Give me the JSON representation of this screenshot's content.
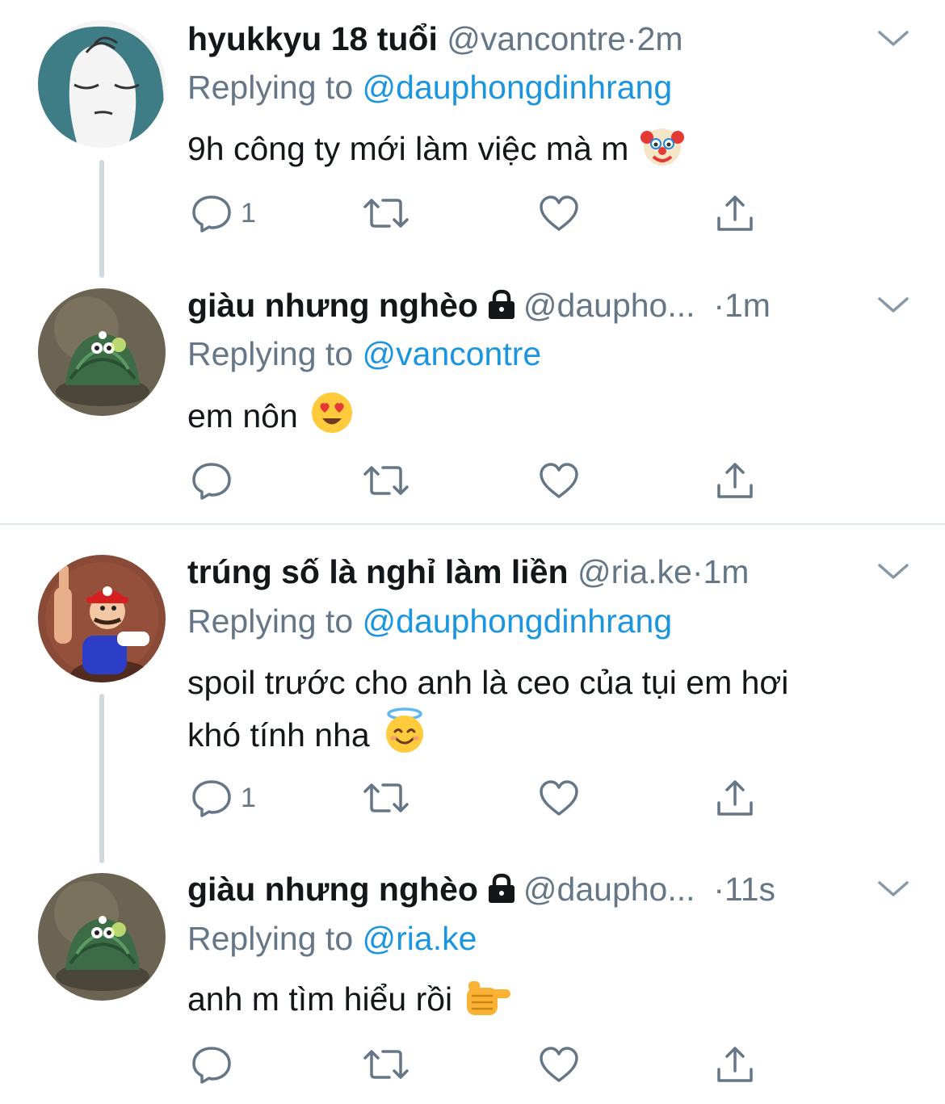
{
  "colors": {
    "name": "#14171a",
    "meta": "#657786",
    "mention": "#1b95e0",
    "icon": "#657786",
    "thread_line": "#cfd9de",
    "divider": "#e1e8ed"
  },
  "icons": {
    "reply": "speech-bubble-icon",
    "retweet": "retweet-icon",
    "like": "heart-icon",
    "share": "share-icon",
    "caret": "chevron-down-icon",
    "lock": "lock-icon"
  },
  "tweets": [
    {
      "name": "hyukkyu 18 tuổi",
      "handle": "@vancontre",
      "separator": "·",
      "time": "2m",
      "replying_prefix": "Replying to",
      "replying_to": "@dauphongdinhrang",
      "text": "9h công ty mới làm việc mà m",
      "emoji": "clown-face",
      "reply_count": "1"
    },
    {
      "name": "giàu nhưng nghèo",
      "handle": "@daupho...",
      "separator": "·",
      "time": "1m",
      "replying_prefix": "Replying to",
      "replying_to": "@vancontre",
      "text": "em nôn",
      "emoji": "heart-eyes-face",
      "reply_count": ""
    },
    {
      "name": "trúng số là nghỉ làm liền",
      "handle": "@ria.ke",
      "separator": "·",
      "time": "1m",
      "replying_prefix": "Replying to",
      "replying_to": "@dauphongdinhrang",
      "text_line1": "spoil trước cho anh là ceo của tụi em hơi",
      "text_line2": "khó tính nha",
      "emoji": "smiling-face-with-halo",
      "reply_count": "1"
    },
    {
      "name": "giàu nhưng nghèo",
      "handle": "@daupho...",
      "separator": "·",
      "time": "11s",
      "replying_prefix": "Replying to",
      "replying_to": "@ria.ke",
      "text": "anh m tìm hiểu rồi",
      "emoji": "backhand-pointing-right",
      "reply_count": ""
    }
  ]
}
